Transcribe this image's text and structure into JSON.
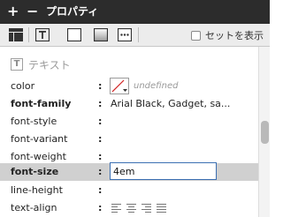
{
  "header": {
    "plus_label": "+",
    "minus_label": "−",
    "title": "プロパティ"
  },
  "toolbar": {
    "buttons": [
      "layout-icon",
      "text-frame-icon",
      "box-icon",
      "gradient-box-icon",
      "more-options-icon"
    ],
    "show_set_label": "セットを表示",
    "show_set_checked": false
  },
  "section": {
    "title": "テキスト",
    "icon": "text-icon"
  },
  "properties": [
    {
      "name": "color",
      "bold": false,
      "value": "undefined"
    },
    {
      "name": "font-family",
      "bold": true,
      "value": "Arial Black, Gadget, sa..."
    },
    {
      "name": "font-style",
      "bold": false,
      "value": ""
    },
    {
      "name": "font-variant",
      "bold": false,
      "value": ""
    },
    {
      "name": "font-weight",
      "bold": false,
      "value": ""
    },
    {
      "name": "font-size",
      "bold": true,
      "value": "4em"
    },
    {
      "name": "line-height",
      "bold": false,
      "value": ""
    },
    {
      "name": "text-align",
      "bold": false,
      "value": ""
    }
  ],
  "colors": {
    "header_bg": "#2c2c2c",
    "toolbar_bg": "#ececec",
    "highlight_row": "#d0d0d0",
    "edit_border": "#3b6fb3",
    "swatch_slash": "#d02020"
  },
  "colon": ":"
}
